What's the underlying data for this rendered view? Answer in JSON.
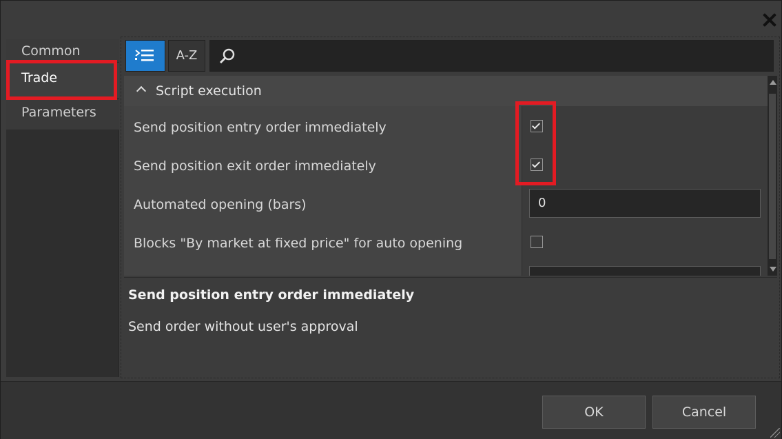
{
  "window": {
    "close_icon": "close-icon"
  },
  "nav": {
    "items": [
      {
        "label": "Common",
        "selected": false
      },
      {
        "label": "Trade",
        "selected": true
      },
      {
        "label": "Parameters",
        "selected": false
      }
    ]
  },
  "toolbar": {
    "category_icon": "categorized-list-icon",
    "az_label": "A-Z",
    "search_icon": "search-icon",
    "search_value": ""
  },
  "grid": {
    "section": {
      "label": "Script execution",
      "expanded": true,
      "icon": "chevron-up-icon"
    },
    "rows": [
      {
        "label": "Send position entry order immediately",
        "type": "checkbox",
        "checked": true
      },
      {
        "label": "Send position exit order immediately",
        "type": "checkbox",
        "checked": true
      },
      {
        "label": "Automated opening (bars)",
        "type": "number",
        "value": "0"
      },
      {
        "label": "Blocks \"By market at fixed price\" for auto opening",
        "type": "checkbox",
        "checked": false
      }
    ]
  },
  "description": {
    "title": "Send position entry order immediately",
    "text": "Send order without user's approval"
  },
  "footer": {
    "ok_label": "OK",
    "cancel_label": "Cancel"
  },
  "colors": {
    "highlight": "#e31b23",
    "accent": "#1f7ccd"
  }
}
